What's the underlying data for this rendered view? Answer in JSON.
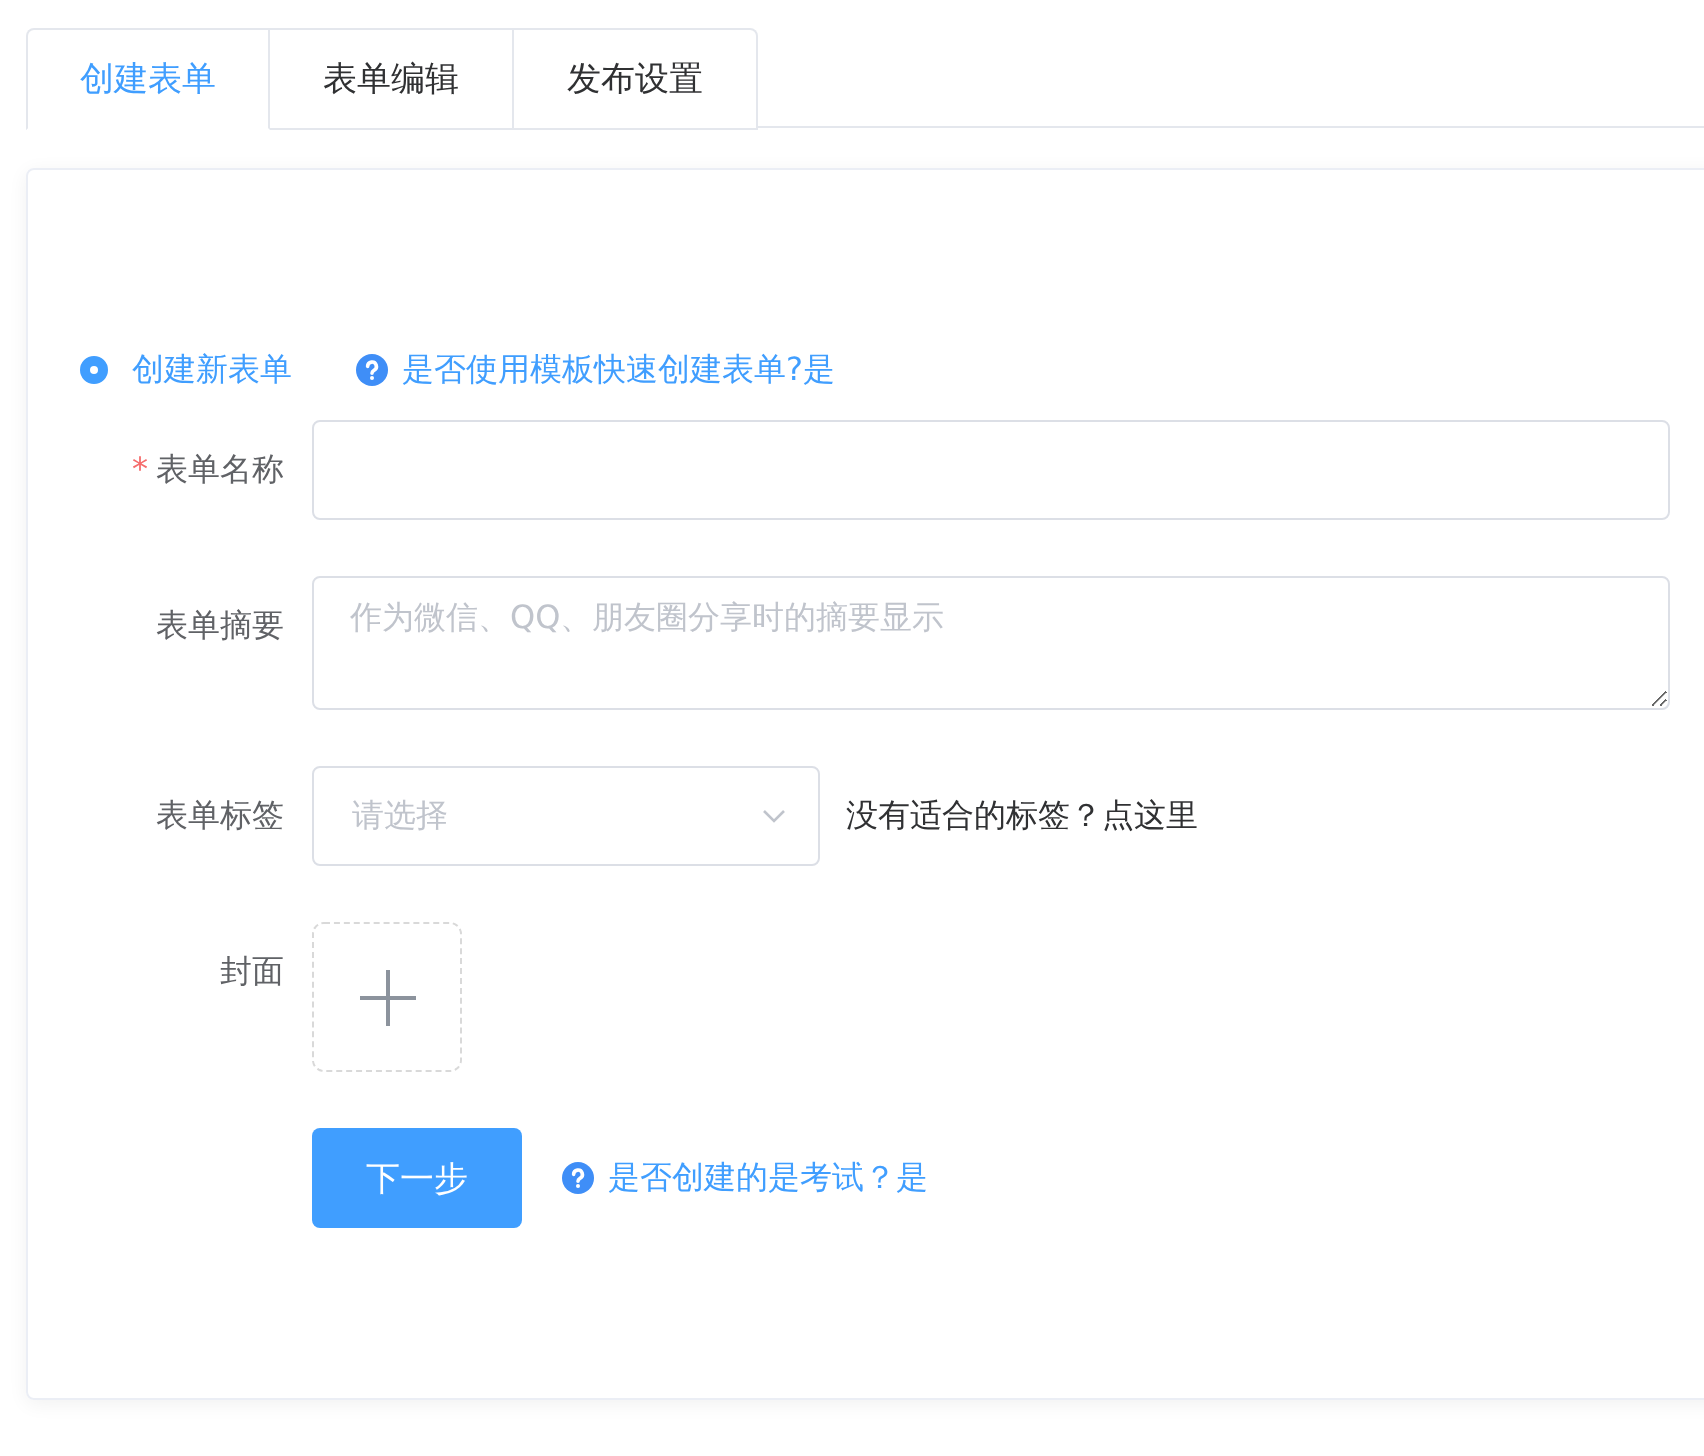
{
  "tabs": [
    {
      "label": "创建表单",
      "selected": true
    },
    {
      "label": "表单编辑",
      "selected": false
    },
    {
      "label": "发布设置",
      "selected": false
    }
  ],
  "mode": {
    "label": "创建新表单",
    "selected": true,
    "template_hint": "是否使用模板快速创建表单?是"
  },
  "fields": [
    {
      "kind": "input",
      "label": "表单名称",
      "required_mark": "*"
    },
    {
      "kind": "textarea",
      "label": "表单摘要",
      "placeholder": "作为微信、QQ、朋友圈分享时的摘要显示"
    },
    {
      "kind": "select",
      "label": "表单标签",
      "placeholder": "请选择",
      "aside": "没有适合的标签？点这里"
    },
    {
      "kind": "upload",
      "label": "封面"
    }
  ],
  "next_button": "下一步",
  "exam_hint": "是否创建的是考试？是"
}
